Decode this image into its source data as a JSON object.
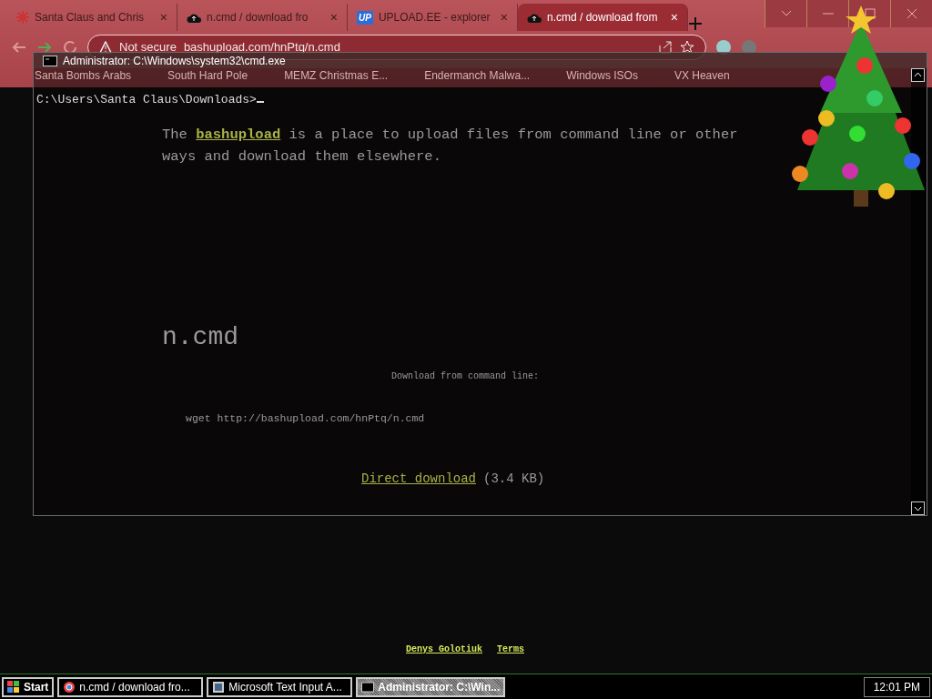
{
  "browser": {
    "tabs": [
      {
        "title": "Santa Claus and Chris",
        "close": "×",
        "selected": false
      },
      {
        "title": "n.cmd / download fro",
        "close": "×",
        "selected": false
      },
      {
        "title": "UPLOAD.EE - explorer",
        "icon_text": "UP",
        "close": "×",
        "selected": false
      },
      {
        "title": "n.cmd / download from",
        "close": "×",
        "selected": true
      }
    ],
    "address": {
      "security": "Not secure",
      "url": "bashupload.com/hnPtq/n.cmd"
    },
    "bookmarks": [
      "Santa Bombs Arabs",
      "South Hard Pole",
      "MEMZ Christmas E...",
      "Endermanch Malwa...",
      "Windows ISOs",
      "VX Heaven"
    ],
    "page": {
      "intro": {
        "prefix": "The",
        "link": "bashupload",
        "suffix": "is a place to upload files from command line or other ways and download them elsewhere."
      },
      "filename": "n.cmd",
      "command_label": "Download from command line:",
      "command": "wget http://bashupload.com/hnPtq/n.cmd",
      "direct_link": "Direct download",
      "size": "(3.4 KB)",
      "footer_links": [
        "Denys Golotiuk",
        "Terms"
      ]
    }
  },
  "cmd": {
    "title": "Administrator: C:\\Windows\\system32\\cmd.exe",
    "prompt": "C:\\Users\\Santa Claus\\Downloads>"
  },
  "taskbar": {
    "start": "Start",
    "items": [
      {
        "label": "n.cmd / download fro...",
        "selected": false
      },
      {
        "label": "Microsoft Text Input A...",
        "selected": false
      },
      {
        "label": "Administrator: C:\\Win...",
        "selected": true
      }
    ],
    "clock": "12:01 PM"
  }
}
